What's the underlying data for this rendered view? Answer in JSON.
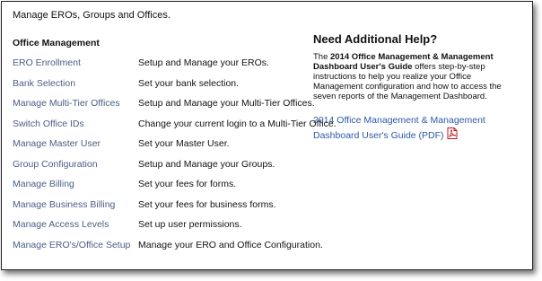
{
  "intro_text": "Manage EROs, Groups and Offices.",
  "section_title": "Office Management",
  "menu": [
    {
      "label": "ERO Enrollment",
      "description": "Setup and Manage your EROs."
    },
    {
      "label": "Bank Selection",
      "description": "Set your bank selection."
    },
    {
      "label": "Manage Multi-Tier Offices",
      "description": "Setup and Manage your Multi-Tier Offices."
    },
    {
      "label": "Switch Office IDs",
      "description": "Change your current login to a Multi-Tier Office."
    },
    {
      "label": "Manage Master User",
      "description": "Set your Master User."
    },
    {
      "label": "Group Configuration",
      "description": "Setup and Manage your Groups."
    },
    {
      "label": "Manage Billing",
      "description": "Set your fees for forms."
    },
    {
      "label": "Manage Business Billing",
      "description": "Set your fees for business forms."
    },
    {
      "label": "Manage Access Levels",
      "description": "Set up user permissions."
    },
    {
      "label": "Manage ERO's/Office Setup",
      "description": "Manage your ERO and Office Configuration."
    }
  ],
  "help": {
    "title": "Need Additional Help?",
    "text_prefix": "The ",
    "guide_name": "2014 Office Management & Management Dashboard User's Guide",
    "text_suffix": " offers step-by-step instructions to help you realize your Office Management configuration and how to access the seven reports of the Management Dashboard.",
    "link_text": "2014 Office Management & Management Dashboard User's Guide (PDF)",
    "icon": "pdf-icon"
  }
}
